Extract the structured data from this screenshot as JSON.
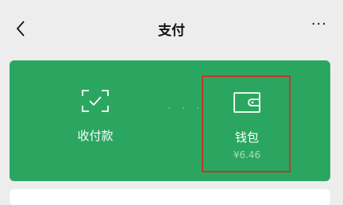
{
  "header": {
    "title": "支付",
    "more": "···"
  },
  "services": {
    "pay": {
      "label": "收付款"
    },
    "wallet": {
      "label": "钱包",
      "balance": "¥6.46"
    }
  },
  "colors": {
    "card_green": "#2ba660",
    "highlight": "#c0392b",
    "background": "#ededed"
  },
  "icons": {
    "back": "chevron-left-icon",
    "more": "more-dots-icon",
    "pay": "scan-check-icon",
    "wallet": "wallet-icon"
  }
}
